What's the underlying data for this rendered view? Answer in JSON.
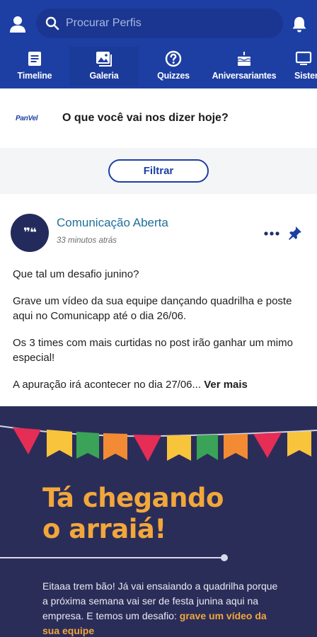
{
  "header": {
    "search_placeholder": "Procurar Perfis",
    "tabs": [
      {
        "label": "Timeline",
        "icon": "list-icon"
      },
      {
        "label": "Galeria",
        "icon": "image-icon"
      },
      {
        "label": "Quizzes",
        "icon": "question-icon"
      },
      {
        "label": "Aniversariantes",
        "icon": "cake-icon"
      },
      {
        "label": "Sister",
        "icon": "monitor-icon"
      }
    ]
  },
  "composer": {
    "logo_text": "PanVel",
    "prompt": "O que você vai nos dizer hoje?"
  },
  "filter": {
    "label": "Filtrar"
  },
  "post": {
    "avatar_text": "❞❝",
    "author": "Comunicação Aberta",
    "time": "33 minutos atrás",
    "paragraphs": [
      "Que tal um desafio junino?",
      "Grave um vídeo da sua equipe dançando quadrilha e poste aqui no Comunicapp até o dia 26/06.",
      "Os 3 times com mais curtidas no post irão ganhar um mimo especial!"
    ],
    "last_paragraph": "A apuração irá acontecer no dia 27/06...",
    "see_more": "Ver mais",
    "image": {
      "title_line1": "Tá chegando",
      "title_line2": "o arraiá!",
      "body_text": "Eitaaa trem bão! Já vai ensaiando a quadrilha porque a próxima semana vai ser de festa junina aqui na empresa. E temos um desafio:",
      "body_bold": "grave um vídeo da sua equipe"
    }
  },
  "colors": {
    "header_bg": "#1d3fa3",
    "author": "#1f6f9a",
    "banner_bg": "#2b2d59",
    "banner_title": "#f2a73b"
  }
}
